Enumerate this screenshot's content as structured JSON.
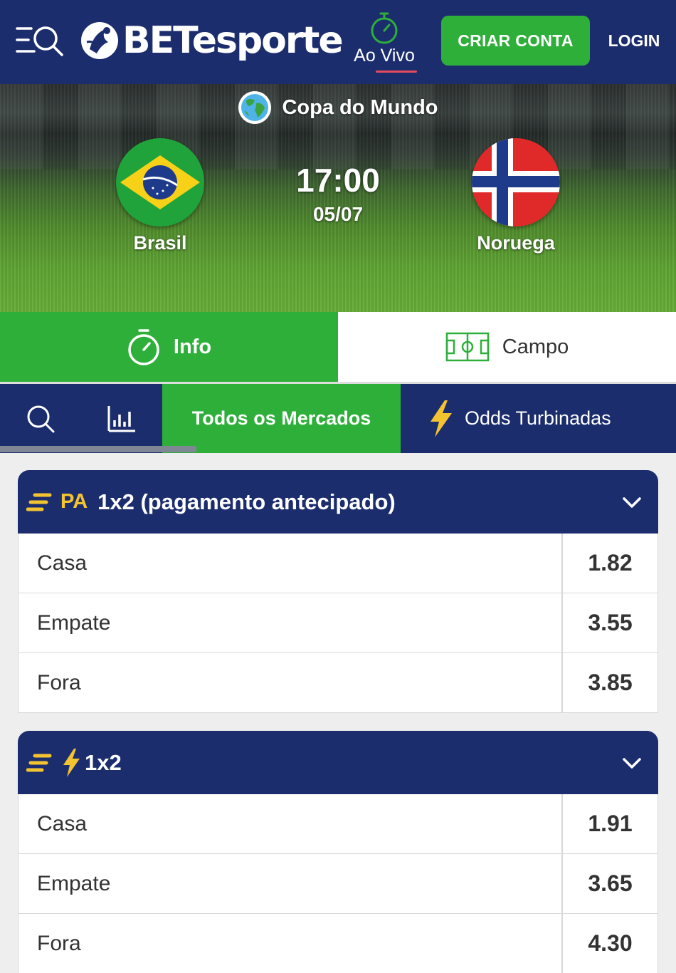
{
  "header": {
    "brand": "BETesporte",
    "live_label": "Ao Vivo",
    "signup_label": "CRIAR CONTA",
    "login_label": "LOGIN"
  },
  "event": {
    "competition": "Copa do Mundo",
    "home_team": "Brasil",
    "away_team": "Noruega",
    "time": "17:00",
    "date": "05/07"
  },
  "view_tabs": {
    "info": "Info",
    "field": "Campo"
  },
  "market_nav": {
    "all_markets": "Todos os Mercados",
    "boosted_odds": "Odds Turbinadas",
    "scroll_position": 0.29
  },
  "markets": [
    {
      "badge": "PA",
      "title": "1x2 (pagamento antecipado)",
      "outcomes": [
        {
          "label": "Casa",
          "odds": "1.82"
        },
        {
          "label": "Empate",
          "odds": "3.55"
        },
        {
          "label": "Fora",
          "odds": "3.85"
        }
      ]
    },
    {
      "title": "1x2",
      "outcomes": [
        {
          "label": "Casa",
          "odds": "1.91"
        },
        {
          "label": "Empate",
          "odds": "3.65"
        },
        {
          "label": "Fora",
          "odds": "4.30"
        }
      ]
    }
  ],
  "colors": {
    "navy": "#1c2d6e",
    "green": "#2eaf3a",
    "yellow": "#f4c430",
    "live_underline": "#e64a5e"
  },
  "icons": [
    "menu-search-icon",
    "soccer-ball-logo-icon",
    "stopwatch-icon",
    "globe-icon",
    "brazil-flag",
    "norway-flag",
    "soccer-field-icon",
    "search-icon",
    "stats-chart-icon",
    "lightning-bolt-icon",
    "boost-lines-icon",
    "chevron-down-icon"
  ]
}
